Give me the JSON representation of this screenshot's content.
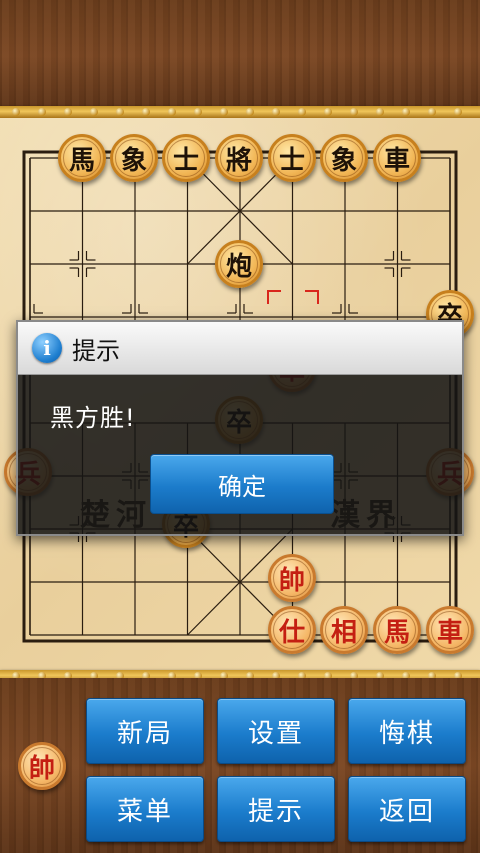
{
  "board": {
    "river_left": "楚河",
    "river_right": "漢界",
    "pieces": [
      {
        "id": "b-horse-l",
        "side": "black",
        "char": "馬",
        "col": 0,
        "row": 0
      },
      {
        "id": "b-elephant-l",
        "side": "black",
        "char": "象",
        "col": 1,
        "row": 0
      },
      {
        "id": "b-advisor-l",
        "side": "black",
        "char": "士",
        "col": 2,
        "row": 0
      },
      {
        "id": "b-general",
        "side": "black",
        "char": "將",
        "col": 3,
        "row": 0
      },
      {
        "id": "b-advisor-r",
        "side": "black",
        "char": "士",
        "col": 4,
        "row": 0
      },
      {
        "id": "b-elephant-r",
        "side": "black",
        "char": "象",
        "col": 5,
        "row": 0
      },
      {
        "id": "b-chariot-r",
        "side": "black",
        "char": "車",
        "col": 6,
        "row": 0
      },
      {
        "id": "b-cannon",
        "side": "black",
        "char": "炮",
        "col": 3,
        "row": 2
      },
      {
        "id": "b-soldier-right",
        "side": "black",
        "char": "卒",
        "col": 8,
        "row": 3
      },
      {
        "id": "b-soldier-mid",
        "side": "black",
        "char": "卒",
        "col": 3,
        "row": 5
      },
      {
        "id": "b-soldier-low",
        "side": "black",
        "char": "卒",
        "col": 2,
        "row": 7
      },
      {
        "id": "r-chariot-mid",
        "side": "red",
        "char": "車",
        "col": 4,
        "row": 4
      },
      {
        "id": "r-soldier-left",
        "side": "red",
        "char": "兵",
        "col": 0,
        "row": 6
      },
      {
        "id": "r-soldier-right",
        "side": "red",
        "char": "兵",
        "col": 8,
        "row": 6
      },
      {
        "id": "r-general",
        "side": "red",
        "char": "帥",
        "col": 4,
        "row": 8
      },
      {
        "id": "r-advisor",
        "side": "red",
        "char": "仕",
        "col": 4,
        "row": 9
      },
      {
        "id": "r-elephant",
        "side": "red",
        "char": "相",
        "col": 5,
        "row": 9
      },
      {
        "id": "r-horse",
        "side": "red",
        "char": "馬",
        "col": 6,
        "row": 9
      },
      {
        "id": "r-chariot-r",
        "side": "red",
        "char": "車",
        "col": 7,
        "row": 9
      }
    ]
  },
  "dialog": {
    "title": "提示",
    "message": "黑方胜!",
    "confirm_label": "确定"
  },
  "controls": {
    "turn_indicator": "帥",
    "new_game": "新局",
    "settings": "设置",
    "undo": "悔棋",
    "menu": "菜单",
    "hint": "提示",
    "back": "返回"
  },
  "colors": {
    "button_blue": "#1c7ccb",
    "red_piece_text": "#c41f12",
    "black_piece_text": "#1e1207"
  },
  "icons": {
    "dialog_icon": "info-icon"
  }
}
